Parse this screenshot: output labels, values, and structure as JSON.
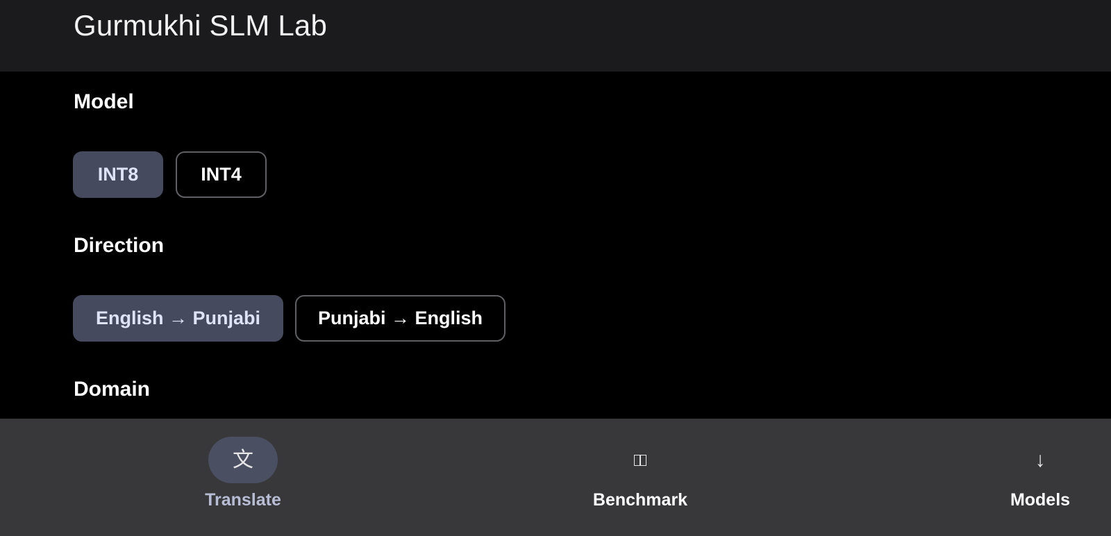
{
  "header": {
    "title": "Gurmukhi SLM Lab"
  },
  "sections": {
    "model": {
      "label": "Model",
      "options": [
        "INT8",
        "INT4"
      ],
      "selected": "INT8"
    },
    "direction": {
      "label": "Direction",
      "options": [
        "English → Punjabi",
        "Punjabi → English"
      ],
      "selected": "English → Punjabi"
    },
    "domain": {
      "label": "Domain"
    }
  },
  "nav": {
    "items": [
      {
        "label": "Translate",
        "icon": "文",
        "icon_name": "translate-icon",
        "active": true
      },
      {
        "label": "Benchmark",
        "icon": "",
        "icon_name": "book-icon",
        "active": false
      },
      {
        "label": "Models",
        "icon": "↓",
        "icon_name": "download-icon",
        "active": false
      }
    ]
  },
  "colors": {
    "top_bar": "#1b1b1d",
    "background": "#000000",
    "chip_selected": "#454a5e",
    "chip_border": "#5f6064",
    "bottom_nav": "#38383b",
    "nav_pill_active": "#4a4f62"
  }
}
